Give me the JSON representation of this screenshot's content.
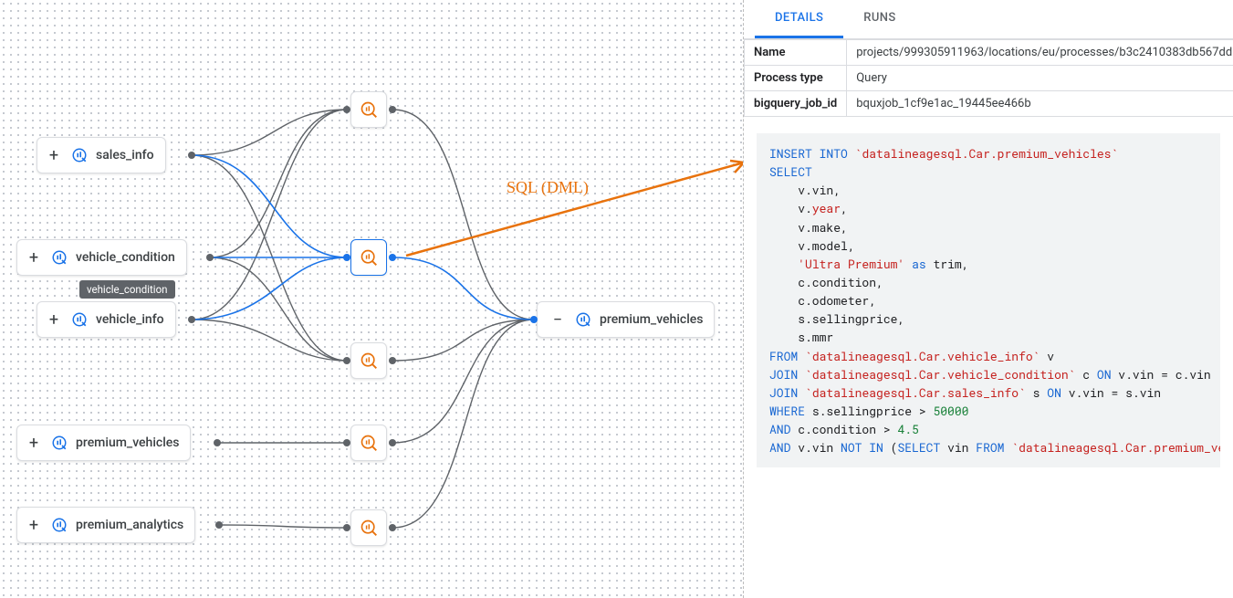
{
  "annotation": {
    "text": "SQL (DML)"
  },
  "tooltip": {
    "text": "vehicle_condition"
  },
  "nodes": {
    "sales_info": {
      "expander": "+",
      "label": "sales_info"
    },
    "vehicle_condition": {
      "expander": "+",
      "label": "vehicle_condition"
    },
    "vehicle_info": {
      "expander": "+",
      "label": "vehicle_info"
    },
    "premium_vehicles": {
      "expander": "+",
      "label": "premium_vehicles"
    },
    "premium_analytics": {
      "expander": "+",
      "label": "premium_analytics"
    },
    "target": {
      "expander": "−",
      "label": "premium_vehicles"
    }
  },
  "details": {
    "tabs": {
      "details": "DETAILS",
      "runs": "RUNS"
    },
    "props": [
      {
        "k": "Name",
        "v": "projects/999305911963/locations/eu/processes/b3c2410383db567dd"
      },
      {
        "k": "Process type",
        "v": "Query"
      },
      {
        "k": "bigquery_job_id",
        "v": "bquxjob_1cf9e1ac_19445ee466b"
      }
    ],
    "sql": {
      "lines": [
        [
          {
            "t": "INSERT INTO",
            "c": "kw"
          },
          {
            "t": " "
          },
          {
            "t": "`datalineagesql.Car.premium_vehicles`",
            "c": "str"
          }
        ],
        [
          {
            "t": "SELECT",
            "c": "kw"
          }
        ],
        [
          {
            "t": "    v.vin,"
          }
        ],
        [
          {
            "t": "    v."
          },
          {
            "t": "year",
            "c": "yr"
          },
          {
            "t": ","
          }
        ],
        [
          {
            "t": "    v.make,"
          }
        ],
        [
          {
            "t": "    v.model,"
          }
        ],
        [
          {
            "t": "    "
          },
          {
            "t": "'Ultra Premium'",
            "c": "str"
          },
          {
            "t": " "
          },
          {
            "t": "as",
            "c": "kw"
          },
          {
            "t": " trim,"
          }
        ],
        [
          {
            "t": "    c.condition,"
          }
        ],
        [
          {
            "t": "    c.odometer,"
          }
        ],
        [
          {
            "t": "    s.sellingprice,"
          }
        ],
        [
          {
            "t": "    s.mmr"
          }
        ],
        [
          {
            "t": "FROM",
            "c": "kw"
          },
          {
            "t": " "
          },
          {
            "t": "`datalineagesql.Car.vehicle_info`",
            "c": "str"
          },
          {
            "t": " v"
          }
        ],
        [
          {
            "t": "JOIN",
            "c": "kw"
          },
          {
            "t": " "
          },
          {
            "t": "`datalineagesql.Car.vehicle_condition`",
            "c": "str"
          },
          {
            "t": " c "
          },
          {
            "t": "ON",
            "c": "kw"
          },
          {
            "t": " v.vin = c.vin"
          }
        ],
        [
          {
            "t": "JOIN",
            "c": "kw"
          },
          {
            "t": " "
          },
          {
            "t": "`datalineagesql.Car.sales_info`",
            "c": "str"
          },
          {
            "t": " s "
          },
          {
            "t": "ON",
            "c": "kw"
          },
          {
            "t": " v.vin = s.vin"
          }
        ],
        [
          {
            "t": "WHERE",
            "c": "kw"
          },
          {
            "t": " s.sellingprice > "
          },
          {
            "t": "50000",
            "c": "num"
          }
        ],
        [
          {
            "t": "AND",
            "c": "kw"
          },
          {
            "t": " c.condition > "
          },
          {
            "t": "4.5",
            "c": "num"
          }
        ],
        [
          {
            "t": "AND ",
            "c": "kw"
          },
          {
            "t": "v.vin "
          },
          {
            "t": "NOT IN",
            "c": "kw"
          },
          {
            "t": " ("
          },
          {
            "t": "SELECT",
            "c": "kw"
          },
          {
            "t": " vin "
          },
          {
            "t": "FROM",
            "c": "kw"
          },
          {
            "t": " "
          },
          {
            "t": "`datalineagesql.Car.premium_vehicles`",
            "c": "str"
          },
          {
            "t": ");"
          }
        ]
      ]
    }
  }
}
